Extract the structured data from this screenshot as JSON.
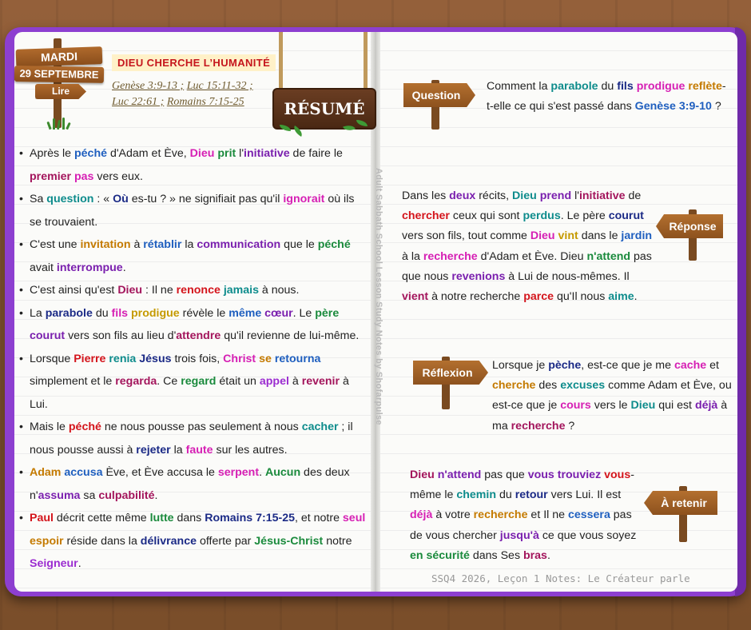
{
  "date_sign": {
    "day": "MARDI",
    "date": "29 SEPTEMBRE",
    "read": "Lire"
  },
  "lesson_title": "DIEU CHERCHE L’HUMANITÉ",
  "references": [
    "Genèse 3:9-13 ;",
    "Luc 15:11-32 ;",
    "Luc 22:61 ;",
    "Romains 7:15-25"
  ],
  "summary_sign": "RÉSUMÉ",
  "spine_text": "Adult Sabbath School Lesson Study Notes by Shofarpulse",
  "bullets": [
    [
      [
        "Après le ",
        ""
      ],
      [
        "péché",
        "blue"
      ],
      [
        " d'Adam et Ève, ",
        ""
      ],
      [
        "Dieu",
        "magenta"
      ],
      [
        " ",
        ""
      ],
      [
        "prit",
        "green"
      ],
      [
        " l'",
        ""
      ],
      [
        "initiative",
        "purple"
      ],
      [
        " de faire le ",
        ""
      ],
      [
        "premier",
        "maroon"
      ],
      [
        " ",
        ""
      ],
      [
        "pas",
        "magenta"
      ],
      [
        " vers eux.",
        ""
      ]
    ],
    [
      [
        "Sa ",
        ""
      ],
      [
        "question",
        "teal"
      ],
      [
        " : « ",
        ""
      ],
      [
        "Où",
        "navy"
      ],
      [
        " es-tu ? » ne signifiait pas qu'il ",
        ""
      ],
      [
        "ignorait",
        "magenta"
      ],
      [
        " où ils se trouvaient.",
        ""
      ]
    ],
    [
      [
        "C'est une ",
        ""
      ],
      [
        "invitation",
        "orange"
      ],
      [
        " à ",
        ""
      ],
      [
        "rétablir",
        "blue"
      ],
      [
        " la ",
        ""
      ],
      [
        "communication",
        "purple"
      ],
      [
        " que le ",
        ""
      ],
      [
        "péché",
        "green"
      ],
      [
        " avait ",
        ""
      ],
      [
        "interrompue",
        "purple"
      ],
      [
        ".",
        ""
      ]
    ],
    [
      [
        "C'est ainsi qu'est ",
        ""
      ],
      [
        "Dieu",
        "maroon"
      ],
      [
        " : Il ne ",
        ""
      ],
      [
        "renonce",
        "red"
      ],
      [
        " ",
        ""
      ],
      [
        "jamais",
        "teal"
      ],
      [
        " à nous.",
        ""
      ]
    ],
    [
      [
        "La ",
        ""
      ],
      [
        "parabole",
        "navy"
      ],
      [
        " du ",
        ""
      ],
      [
        "fils",
        "magenta"
      ],
      [
        " ",
        ""
      ],
      [
        "prodigue",
        "gold"
      ],
      [
        " révèle le ",
        ""
      ],
      [
        "même",
        "blue"
      ],
      [
        " ",
        ""
      ],
      [
        "cœur",
        "purple"
      ],
      [
        ". Le ",
        ""
      ],
      [
        "père",
        "green"
      ],
      [
        " ",
        ""
      ],
      [
        "courut",
        "purple"
      ],
      [
        " vers son fils au lieu d'",
        ""
      ],
      [
        "attendre",
        "maroon"
      ],
      [
        " qu'il revienne de lui-même.",
        ""
      ]
    ],
    [
      [
        "Lorsque ",
        ""
      ],
      [
        "Pierre",
        "red"
      ],
      [
        " ",
        ""
      ],
      [
        "renia",
        "teal"
      ],
      [
        " ",
        ""
      ],
      [
        "Jésus",
        "navy"
      ],
      [
        " trois fois, ",
        ""
      ],
      [
        "Christ",
        "magenta"
      ],
      [
        " ",
        ""
      ],
      [
        "se",
        "orange"
      ],
      [
        " ",
        ""
      ],
      [
        "retourna",
        "blue"
      ],
      [
        " simplement et le ",
        ""
      ],
      [
        "regarda",
        "maroon"
      ],
      [
        ". Ce ",
        ""
      ],
      [
        "regard",
        "green"
      ],
      [
        " était un ",
        ""
      ],
      [
        "appel",
        "violet"
      ],
      [
        " à ",
        ""
      ],
      [
        "revenir",
        "maroon"
      ],
      [
        " à Lui.",
        ""
      ]
    ],
    [
      [
        "Mais le ",
        ""
      ],
      [
        "péché",
        "red"
      ],
      [
        " ne nous pousse pas seulement à nous ",
        ""
      ],
      [
        "cacher",
        "teal"
      ],
      [
        " ; il nous pousse aussi à ",
        ""
      ],
      [
        "rejeter",
        "navy"
      ],
      [
        " la ",
        ""
      ],
      [
        "faute",
        "magenta"
      ],
      [
        " sur les autres.",
        ""
      ]
    ],
    [
      [
        "Adam",
        "orange"
      ],
      [
        " ",
        ""
      ],
      [
        "accusa",
        "blue"
      ],
      [
        " Ève, et Ève accusa le ",
        ""
      ],
      [
        "serpent",
        "magenta"
      ],
      [
        ". ",
        ""
      ],
      [
        "Aucun",
        "green"
      ],
      [
        " des deux n'",
        ""
      ],
      [
        "assuma",
        "purple"
      ],
      [
        " sa ",
        ""
      ],
      [
        "culpabilité",
        "maroon"
      ],
      [
        ".",
        ""
      ]
    ],
    [
      [
        "Paul",
        "red"
      ],
      [
        " décrit cette même ",
        ""
      ],
      [
        "lutte",
        "green"
      ],
      [
        " dans ",
        ""
      ],
      [
        "Romains 7:15-25",
        "navy"
      ],
      [
        ", et notre ",
        ""
      ],
      [
        "seul",
        "magenta"
      ],
      [
        " ",
        ""
      ],
      [
        "espoir",
        "orange"
      ],
      [
        " réside dans la ",
        ""
      ],
      [
        "délivrance",
        "navy"
      ],
      [
        " offerte par ",
        ""
      ],
      [
        "Jésus-Christ",
        "green"
      ],
      [
        " notre ",
        ""
      ],
      [
        "Seigneur",
        "violet"
      ],
      [
        ".",
        ""
      ]
    ]
  ],
  "question": {
    "label": "Question",
    "text": [
      [
        "Comment la ",
        ""
      ],
      [
        "parabole",
        "teal"
      ],
      [
        " du ",
        ""
      ],
      [
        "fils",
        "navy"
      ],
      [
        " ",
        ""
      ],
      [
        "prodigue",
        "magenta"
      ],
      [
        " ",
        ""
      ],
      [
        "reflète",
        "orange"
      ],
      [
        "-t-elle ce qui s'est passé dans ",
        ""
      ],
      [
        "Genèse 3:9-10",
        "blue"
      ],
      [
        " ?",
        ""
      ]
    ]
  },
  "reponse": {
    "label": "Réponse",
    "text": [
      [
        "Dans les ",
        ""
      ],
      [
        "deux",
        "purple"
      ],
      [
        " récits, ",
        ""
      ],
      [
        "Dieu",
        "teal"
      ],
      [
        " ",
        ""
      ],
      [
        "prend",
        "purple"
      ],
      [
        " l'",
        ""
      ],
      [
        "initiative",
        "maroon"
      ],
      [
        " de ",
        ""
      ],
      [
        "chercher",
        "red"
      ],
      [
        " ceux qui sont ",
        ""
      ],
      [
        "perdus",
        "teal"
      ],
      [
        ". Le père ",
        ""
      ],
      [
        "courut",
        "navy"
      ],
      [
        " vers son fils, tout comme ",
        ""
      ],
      [
        "Dieu",
        "magenta"
      ],
      [
        " ",
        ""
      ],
      [
        "vint",
        "gold"
      ],
      [
        " dans le ",
        ""
      ],
      [
        "jardin",
        "blue"
      ],
      [
        " à la ",
        ""
      ],
      [
        "recherche",
        "magenta"
      ],
      [
        " d'Adam et Ève. Dieu ",
        ""
      ],
      [
        "n'attend",
        "green"
      ],
      [
        " pas que nous ",
        ""
      ],
      [
        "revenions",
        "purple"
      ],
      [
        " à Lui de nous-mêmes. Il ",
        ""
      ],
      [
        "vient",
        "maroon"
      ],
      [
        " à notre recherche ",
        ""
      ],
      [
        "parce",
        "red"
      ],
      [
        " qu'Il nous ",
        ""
      ],
      [
        "aime",
        "teal"
      ],
      [
        ".",
        ""
      ]
    ]
  },
  "reflexion": {
    "label": "Réflexion",
    "text": [
      [
        "Lorsque je ",
        ""
      ],
      [
        "pèche",
        "navy"
      ],
      [
        ", est-ce que je me ",
        ""
      ],
      [
        "cache",
        "magenta"
      ],
      [
        " et ",
        ""
      ],
      [
        "cherche",
        "orange"
      ],
      [
        " des ",
        ""
      ],
      [
        "excuses",
        "teal"
      ],
      [
        " comme Adam et Ève, ou est-ce que je ",
        ""
      ],
      [
        "cours",
        "magenta"
      ],
      [
        " vers le ",
        ""
      ],
      [
        "Dieu",
        "teal"
      ],
      [
        " qui est ",
        ""
      ],
      [
        "déjà",
        "purple"
      ],
      [
        " à ma ",
        ""
      ],
      [
        "recherche",
        "maroon"
      ],
      [
        " ?",
        ""
      ]
    ]
  },
  "a_retenir": {
    "label": "À retenir",
    "text": [
      [
        "Dieu",
        "maroon"
      ],
      [
        " ",
        ""
      ],
      [
        "n'attend",
        "purple"
      ],
      [
        " pas que ",
        ""
      ],
      [
        "vous",
        "purple"
      ],
      [
        " ",
        ""
      ],
      [
        "trouviez",
        "purple"
      ],
      [
        " ",
        ""
      ],
      [
        "vous",
        "red"
      ],
      [
        "-même le ",
        ""
      ],
      [
        "chemin",
        "teal"
      ],
      [
        " du ",
        ""
      ],
      [
        "retour",
        "navy"
      ],
      [
        " vers Lui. Il est ",
        ""
      ],
      [
        "déjà",
        "magenta"
      ],
      [
        " à votre ",
        ""
      ],
      [
        "recherche",
        "orange"
      ],
      [
        " et Il ne ",
        ""
      ],
      [
        "cessera",
        "blue"
      ],
      [
        " pas de vous chercher ",
        ""
      ],
      [
        "jusqu'à",
        "purple"
      ],
      [
        " ce que vous soyez ",
        ""
      ],
      [
        "en",
        "green"
      ],
      [
        " ",
        ""
      ],
      [
        "sécurité",
        "green"
      ],
      [
        " dans Ses ",
        ""
      ],
      [
        "bras",
        "maroon"
      ],
      [
        ".",
        ""
      ]
    ]
  },
  "footer": "SSQ4 2026, Leçon 1 Notes: Le Créateur parle",
  "colors": {
    "cover": "#8d3fd0",
    "wood": "#a5612a",
    "title_red": "#c5161d",
    "title_bg": "#fff1c8"
  }
}
